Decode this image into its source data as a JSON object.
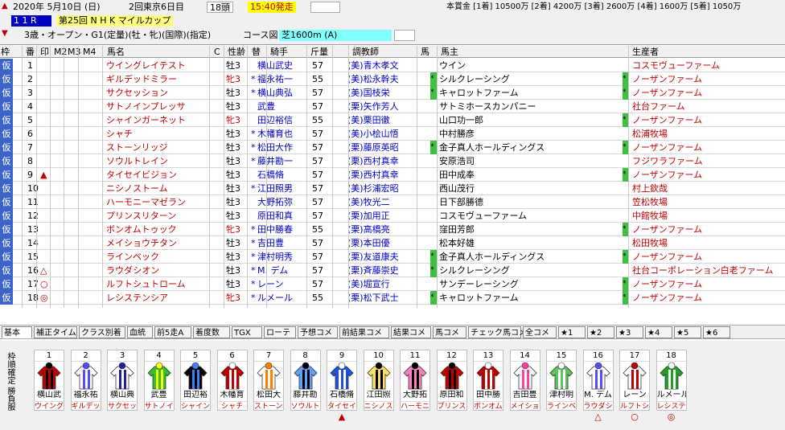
{
  "header": {
    "date": "2020年 5月10日 (日)",
    "meeting": "2回東京6日目",
    "heads": "18頭",
    "start": "15:40発走",
    "race_no": "1 1 R",
    "race_name": "第25回 N H K マイルカップ",
    "conditions": "3歳・オープン・G1(定量)(牡・牝)(国際)(指定)",
    "course_label": "コース図",
    "course": "芝1600m (A)",
    "prize": "本賞金 [1着] 10500万 [2着] 4200万 [3着] 2600万 [4着] 1600万 [5着] 1050万"
  },
  "columns": [
    "枠",
    "番",
    "印",
    "M2",
    "M3",
    "M4",
    "馬名",
    "C",
    "性齢",
    "替",
    "騎手",
    "斤量",
    "",
    "調教師",
    "馬",
    "馬主",
    "生産者"
  ],
  "rows": [
    {
      "w": "仮",
      "n": "1",
      "mark": "",
      "horse": "ウイングレイテスト",
      "sex": "牡3",
      "chg": "",
      "jockey": "横山武史",
      "kin": "57",
      "tr": "(美)青木孝文",
      "s1": "",
      "owner": "ウイン",
      "s2": "",
      "breeder": "コスモヴューファーム"
    },
    {
      "w": "仮",
      "n": "2",
      "mark": "",
      "horse": "ギルデッドミラー",
      "sex": "牝3",
      "chg": "*",
      "jockey": "福永祐一",
      "kin": "55",
      "tr": "(美)松永幹夫",
      "s1": "*",
      "owner": "シルクレーシング",
      "s2": "*",
      "breeder": "ノーザンファーム"
    },
    {
      "w": "仮",
      "n": "3",
      "mark": "",
      "horse": "サクセッション",
      "sex": "牡3",
      "chg": "*",
      "jockey": "横山典弘",
      "kin": "57",
      "tr": "(美)国枝栄",
      "s1": "*",
      "owner": "キャロットファーム",
      "s2": "*",
      "breeder": "ノーザンファーム"
    },
    {
      "w": "仮",
      "n": "4",
      "mark": "",
      "horse": "サトノインプレッサ",
      "sex": "牡3",
      "chg": "",
      "jockey": "武豊",
      "kin": "57",
      "tr": "(栗)矢作芳人",
      "s1": "",
      "owner": "サトミホースカンパニー",
      "s2": "",
      "breeder": "社台ファーム"
    },
    {
      "w": "仮",
      "n": "5",
      "mark": "",
      "horse": "シャインガーネット",
      "sex": "牝3",
      "chg": "",
      "jockey": "田辺裕信",
      "kin": "55",
      "tr": "(美)栗田徹",
      "s1": "",
      "owner": "山口功一郎",
      "s2": "*",
      "breeder": "ノーザンファーム"
    },
    {
      "w": "仮",
      "n": "6",
      "mark": "",
      "horse": "シャチ",
      "sex": "牡3",
      "chg": "*",
      "jockey": "木幡育也",
      "kin": "57",
      "tr": "(美)小桧山悟",
      "s1": "",
      "owner": "中村勝彦",
      "s2": "",
      "breeder": "松浦牧場"
    },
    {
      "w": "仮",
      "n": "7",
      "mark": "",
      "horse": "ストーンリッジ",
      "sex": "牡3",
      "chg": "*",
      "jockey": "松田大作",
      "kin": "57",
      "tr": "(栗)藤原英昭",
      "s1": "*",
      "owner": "金子真人ホールディングス",
      "s2": "*",
      "breeder": "ノーザンファーム"
    },
    {
      "w": "仮",
      "n": "8",
      "mark": "",
      "horse": "ソウルトレイン",
      "sex": "牡3",
      "chg": "*",
      "jockey": "藤井勘一",
      "kin": "57",
      "tr": "(栗)西村真幸",
      "s1": "",
      "owner": "安原浩司",
      "s2": "",
      "breeder": "フジワラファーム"
    },
    {
      "w": "仮",
      "n": "9",
      "mark": "▲",
      "horse": "タイセイビジョン",
      "sex": "牡3",
      "chg": "",
      "jockey": "石橋脩",
      "kin": "57",
      "tr": "(栗)西村真幸",
      "s1": "",
      "owner": "田中成奉",
      "s2": "*",
      "breeder": "ノーザンファーム"
    },
    {
      "w": "仮",
      "n": "10",
      "mark": "",
      "horse": "ニシノストーム",
      "sex": "牡3",
      "chg": "*",
      "jockey": "江田照男",
      "kin": "57",
      "tr": "(美)杉浦宏昭",
      "s1": "",
      "owner": "西山茂行",
      "s2": "",
      "breeder": "村上欽哉"
    },
    {
      "w": "仮",
      "n": "11",
      "mark": "",
      "horse": "ハーモニーマゼラン",
      "sex": "牡3",
      "chg": "",
      "jockey": "大野拓弥",
      "kin": "57",
      "tr": "(美)牧光二",
      "s1": "",
      "owner": "日下部勝德",
      "s2": "",
      "breeder": "笠松牧場"
    },
    {
      "w": "仮",
      "n": "12",
      "mark": "",
      "horse": "プリンスリターン",
      "sex": "牡3",
      "chg": "",
      "jockey": "原田和真",
      "kin": "57",
      "tr": "(栗)加用正",
      "s1": "",
      "owner": "コスモヴューファーム",
      "s2": "",
      "breeder": "中館牧場"
    },
    {
      "w": "仮",
      "n": "13",
      "mark": "",
      "horse": "ボンオムトゥック",
      "sex": "牝3",
      "chg": "*",
      "jockey": "田中勝春",
      "kin": "55",
      "tr": "(栗)高橋亮",
      "s1": "",
      "owner": "窪田芳郎",
      "s2": "*",
      "breeder": "ノーザンファーム"
    },
    {
      "w": "仮",
      "n": "14",
      "mark": "",
      "horse": "メイショウチタン",
      "sex": "牡3",
      "chg": "*",
      "jockey": "吉田豊",
      "kin": "57",
      "tr": "(栗)本田優",
      "s1": "",
      "owner": "松本好雄",
      "s2": "",
      "breeder": "松田牧場"
    },
    {
      "w": "仮",
      "n": "15",
      "mark": "",
      "horse": "ラインベック",
      "sex": "牡3",
      "chg": "*",
      "jockey": "津村明秀",
      "kin": "57",
      "tr": "(栗)友道康夫",
      "s1": "*",
      "owner": "金子真人ホールディングス",
      "s2": "*",
      "breeder": "ノーザンファーム"
    },
    {
      "w": "仮",
      "n": "16",
      "mark": "△",
      "horse": "ラウダシオン",
      "sex": "牡3",
      "chg": "*",
      "jockey": "M. デム",
      "kin": "57",
      "tr": "(栗)斉藤崇史",
      "s1": "*",
      "owner": "シルクレーシング",
      "s2": "",
      "breeder": "社台コーポレーション白老ファーム"
    },
    {
      "w": "仮",
      "n": "17",
      "mark": "○",
      "horse": "ルフトシュトローム",
      "sex": "牡3",
      "chg": "*",
      "jockey": "レーン",
      "kin": "57",
      "tr": "(美)堀宣行",
      "s1": "",
      "owner": "サンデーレーシング",
      "s2": "*",
      "breeder": "ノーザンファーム"
    },
    {
      "w": "仮",
      "n": "18",
      "mark": "◎",
      "horse": "レシステンシア",
      "sex": "牝3",
      "chg": "*",
      "jockey": "ルメール",
      "kin": "55",
      "tr": "(栗)松下武士",
      "s1": "*",
      "owner": "キャロットファーム",
      "s2": "*",
      "breeder": "ノーザンファーム"
    }
  ],
  "tabs": [
    "基本",
    "補正タイム",
    "クラス別着",
    "血統",
    "前5走A",
    "着度数",
    "TGX",
    "ローテ",
    "予想コメ",
    "前結果コメ",
    "結果コメ",
    "馬コメ",
    "チェック馬コメ",
    "全コメ",
    "★1",
    "★2",
    "★3",
    "★4",
    "★5",
    "★6"
  ],
  "side_label": "枠順確定 勝負服",
  "silks": [
    {
      "n": "1",
      "j": "横山武",
      "h": "ウイングレ",
      "mark": ""
    },
    {
      "n": "2",
      "j": "福永祐",
      "h": "ギルデッド",
      "mark": ""
    },
    {
      "n": "3",
      "j": "横山典",
      "h": "サクセッシ",
      "mark": ""
    },
    {
      "n": "4",
      "j": "武豊",
      "h": "サトノイン",
      "mark": ""
    },
    {
      "n": "5",
      "j": "田辺裕",
      "h": "シャインガ",
      "mark": ""
    },
    {
      "n": "6",
      "j": "木幡育",
      "h": "シャチ",
      "mark": ""
    },
    {
      "n": "7",
      "j": "松田大",
      "h": "ストーンリ",
      "mark": ""
    },
    {
      "n": "8",
      "j": "藤井勘",
      "h": "ソウルトレ",
      "mark": ""
    },
    {
      "n": "9",
      "j": "石橋脩",
      "h": "タイセイビ",
      "mark": "▲"
    },
    {
      "n": "10",
      "j": "江田照",
      "h": "ニシノスト",
      "mark": ""
    },
    {
      "n": "11",
      "j": "大野拓",
      "h": "ハーモニー",
      "mark": ""
    },
    {
      "n": "12",
      "j": "原田和",
      "h": "プリンスリ",
      "mark": ""
    },
    {
      "n": "13",
      "j": "田中勝",
      "h": "ボンオムト",
      "mark": ""
    },
    {
      "n": "14",
      "j": "吉田豊",
      "h": "メイショウ",
      "mark": ""
    },
    {
      "n": "15",
      "j": "津村明",
      "h": "ラインベッ",
      "mark": ""
    },
    {
      "n": "16",
      "j": "M. デム",
      "h": "ラウダシオ",
      "mark": "△"
    },
    {
      "n": "17",
      "j": "レーン",
      "h": "ルフトシュ",
      "mark": "○"
    },
    {
      "n": "18",
      "j": "ルメール",
      "h": "レシステン",
      "mark": "◎"
    }
  ],
  "colors": {
    "kari": "#3c64c8",
    "horse_name": "#c00000",
    "filly": "#c00000",
    "trainer": "#0000c0",
    "start_bg": "#ffff00",
    "course_bg": "#80ffff"
  }
}
